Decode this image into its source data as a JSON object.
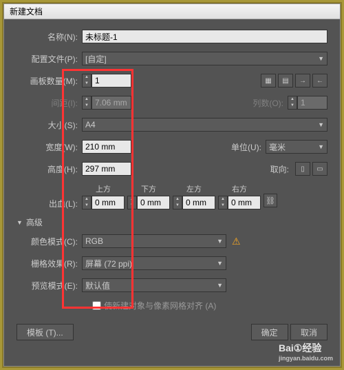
{
  "window": {
    "title": "新建文档"
  },
  "name": {
    "label": "名称(N):",
    "value": "未标题-1"
  },
  "profile": {
    "label": "配置文件(P):",
    "value": "[自定]"
  },
  "artboards": {
    "count_label": "画板数量(M):",
    "count": "1",
    "spacing_label": "间距(I):",
    "spacing": "7.06 mm",
    "cols_label": "列数(O):",
    "cols": "1"
  },
  "size": {
    "label": "大小(S):",
    "value": "A4"
  },
  "width": {
    "label": "宽度(W):",
    "value": "210 mm"
  },
  "height": {
    "label": "高度(H):",
    "value": "297 mm"
  },
  "units": {
    "label": "单位(U):",
    "value": "毫米"
  },
  "orient": {
    "label": "取向:"
  },
  "bleed": {
    "label": "出血(L):",
    "top": "上方",
    "bottom": "下方",
    "left": "左方",
    "right": "右方",
    "top_v": "0 mm",
    "bottom_v": "0 mm",
    "left_v": "0 mm",
    "right_v": "0 mm"
  },
  "advanced": {
    "label": "高级"
  },
  "colormode": {
    "label": "颜色模式(C):",
    "value": "RGB"
  },
  "raster": {
    "label": "栅格效果(R):",
    "value": "屏幕 (72 ppi)"
  },
  "preview": {
    "label": "预览模式(E):",
    "value": "默认值"
  },
  "align": {
    "label": "使新建对象与像素网格对齐 (A)"
  },
  "buttons": {
    "template": "模板 (T)...",
    "ok": "确定",
    "cancel": "取消"
  },
  "watermark": {
    "main": "Bai①经验",
    "sub": "jingyan.baidu.com"
  },
  "colors": {
    "red": "#ff3333"
  }
}
